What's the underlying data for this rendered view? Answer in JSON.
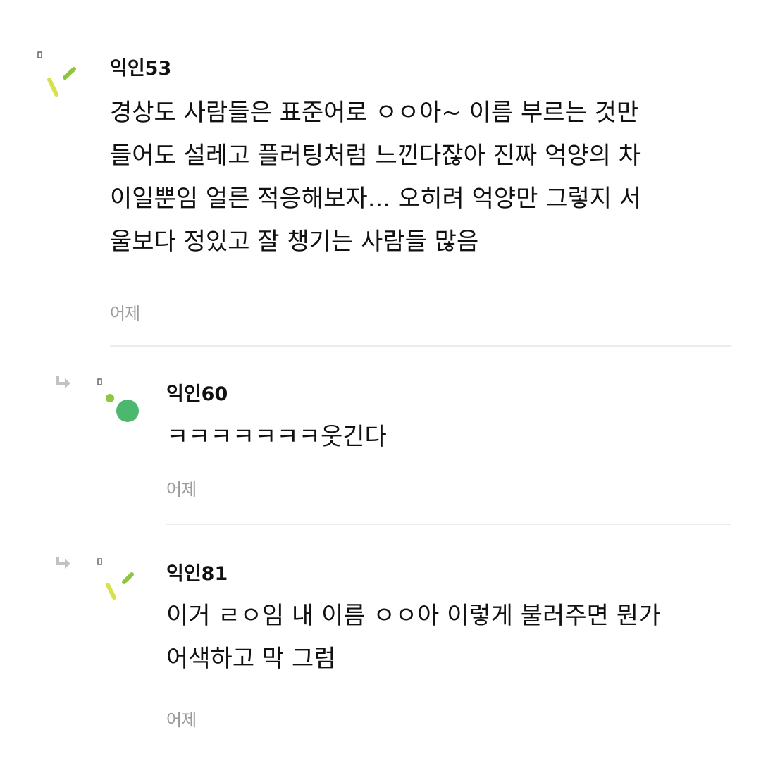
{
  "comments": [
    {
      "author": "익인53",
      "body": "경상도 사람들은 표준어로 ㅇㅇ아~ 이름 부르는 것만\n들어도 설레고 플러팅처럼 느낀다잖아 진짜 억양의 차\n이일뿐임 얼른 적응해보자... 오히려 억양만 그렇지 서\n울보다 정있고 잘 챙기는 사람들 많음",
      "time": "어제",
      "avatar_icon": "green-sprinkle-avatar-icon",
      "is_reply": false
    },
    {
      "author": "익인60",
      "body": "ㅋㅋㅋㅋㅋㅋㅋ웃긴다",
      "time": "어제",
      "avatar_icon": "green-dot-avatar-icon",
      "is_reply": true
    },
    {
      "author": "익인81",
      "body": "이거 ㄹㅇ임 내 이름 ㅇㅇ아 이렇게 불러주면 뭔가\n어색하고 막 그럼",
      "time": "어제",
      "avatar_icon": "green-sprinkle-avatar-icon",
      "is_reply": true
    }
  ],
  "colors": {
    "text": "#111111",
    "timestamp": "#9a9a9a",
    "divider": "#ececec",
    "avatar_green": "#4cb86e",
    "avatar_lime": "#8dc63f",
    "avatar_yellow": "#d7e24a",
    "reply_arrow": "#c2c2c2"
  }
}
